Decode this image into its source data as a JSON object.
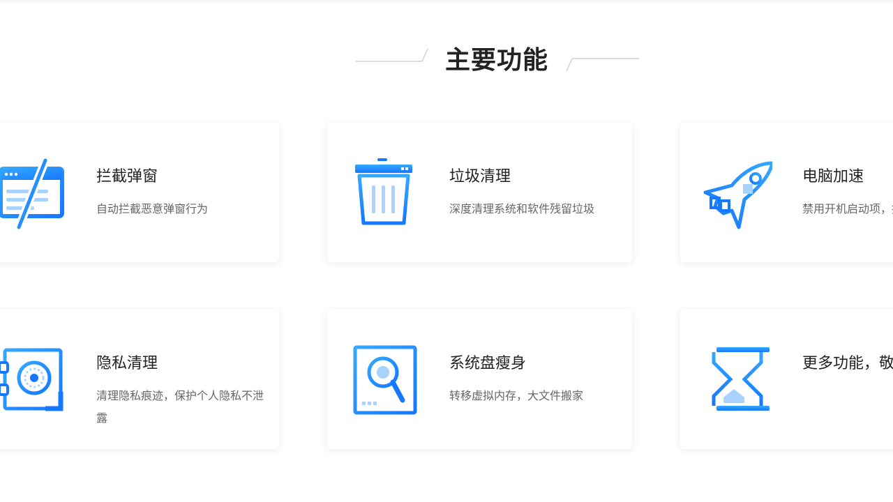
{
  "section": {
    "title": "主要功能"
  },
  "features": [
    {
      "title": "拦截弹窗",
      "desc": "自动拦截恶意弹窗行为",
      "icon": "browser-block-icon"
    },
    {
      "title": "垃圾清理",
      "desc": "深度清理系统和软件残留垃圾",
      "icon": "trash-bin-icon"
    },
    {
      "title": "电脑加速",
      "desc": "禁用开机启动项，提升系统速度",
      "icon": "rocket-icon"
    },
    {
      "title": "隐私清理",
      "desc": "清理隐私痕迹，保护个人隐私不泄露",
      "icon": "safe-icon"
    },
    {
      "title": "系统盘瘦身",
      "desc": "转移虚拟内存，大文件搬家",
      "icon": "disk-search-icon"
    },
    {
      "title": "更多功能，敬请期待",
      "desc": "",
      "icon": "hourglass-icon"
    }
  ],
  "colors": {
    "accent": "#1677ff",
    "accent_light": "#34a8ff",
    "title": "#222222",
    "desc": "#666666"
  }
}
